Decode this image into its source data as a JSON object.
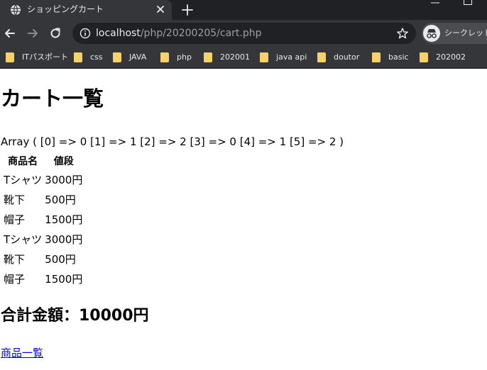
{
  "browser": {
    "tab_title": "ショッピングカート",
    "url_host": "localhost",
    "url_path": "/php/20200205/cart.php",
    "incognito_label": "シークレット",
    "bookmarks": [
      "ITパスポート",
      "css",
      "JAVA",
      "php",
      "202001",
      "java api",
      "doutor",
      "basic",
      "202002"
    ],
    "colors": {
      "frame": "#202124",
      "toolbar": "#35363a",
      "text": "#e8eaed",
      "folder": "#f6d16c"
    }
  },
  "page": {
    "title": "カート一覧",
    "array_dump": "Array ( [0] => 0 [1] => 1 [2] => 2 [3] => 0 [4] => 1 [5] => 2 )",
    "table": {
      "headers": [
        "商品名",
        "値段"
      ],
      "rows": [
        [
          "Tシャツ",
          "3000円"
        ],
        [
          "靴下",
          "500円"
        ],
        [
          "帽子",
          "1500円"
        ],
        [
          "Tシャツ",
          "3000円"
        ],
        [
          "靴下",
          "500円"
        ],
        [
          "帽子",
          "1500円"
        ]
      ]
    },
    "total_text": "合計金額：10000円",
    "link_text": "商品一覧",
    "link_color": "#0000ee"
  }
}
